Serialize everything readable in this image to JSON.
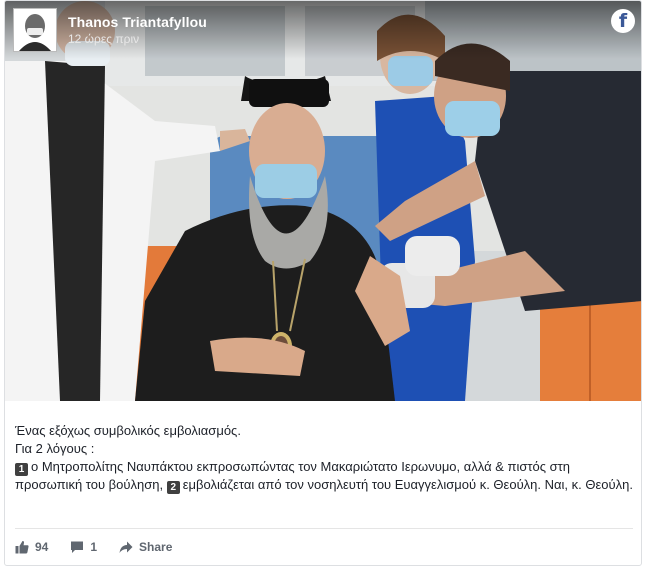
{
  "post": {
    "author": "Thanos Triantafyllou",
    "timestamp": "12 ώρες πριν"
  },
  "icons": {
    "brand": "facebook-icon",
    "like": "thumbs-up-icon",
    "comment": "comment-icon",
    "share": "share-arrow-icon"
  },
  "colors": {
    "facebook_blue": "#3b5998",
    "text": "#1d2129",
    "muted": "#606770"
  },
  "caption": {
    "line1": "Ένας εξόχως συμβολικός εμβολιασμός.",
    "line2": "Για 2 λόγους :",
    "badge1": "1",
    "line3a": "ο Μητροπολίτης Ναυπάκτου εκπροσωπώντας τον Μακαριώτατο Ιερωνυμο, αλλά & πιστός στη προσωπική του βούληση,",
    "badge2": "2",
    "line3b": "εμβολιάζεται από τον νοσηλευτή του Ευαγγελισμού κ. Θεούλη. Ναι, κ. Θεούλη."
  },
  "engagement": {
    "likes": "94",
    "comments": "1",
    "share_label": "Share"
  }
}
